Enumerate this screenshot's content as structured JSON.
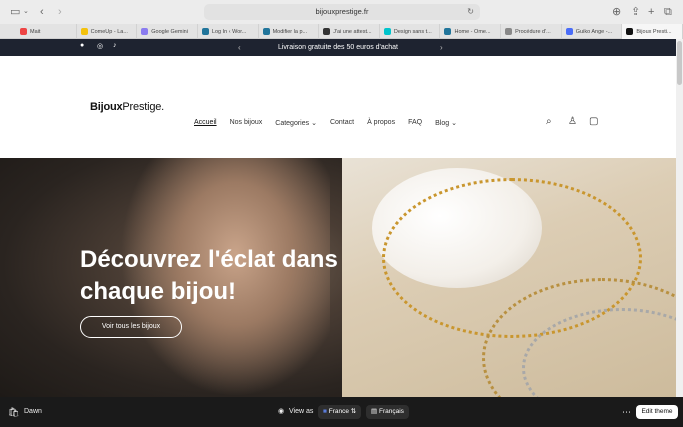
{
  "browser": {
    "url": "bijouxprestige.fr",
    "tabs": [
      {
        "label": "Mait",
        "color": "#e44"
      },
      {
        "label": "ComeUp - La...",
        "color": "#f4c20d"
      },
      {
        "label": "Google Gemini",
        "color": "#8a7cf0"
      },
      {
        "label": "Log In ‹ Wor...",
        "color": "#21759b"
      },
      {
        "label": "Modifier la p...",
        "color": "#21759b"
      },
      {
        "label": "J'ai une attest...",
        "color": "#333"
      },
      {
        "label": "Design sans t...",
        "color": "#00c4cc"
      },
      {
        "label": "Home - Ome...",
        "color": "#21759b"
      },
      {
        "label": "Procédure d'...",
        "color": "#888"
      },
      {
        "label": "Guiko Ange -...",
        "color": "#4a6cf7"
      },
      {
        "label": "Bijoux Presti...",
        "color": "#111"
      }
    ]
  },
  "announcement": {
    "message": "Livraison gratuite des 50 euros d'achat"
  },
  "header": {
    "logo_bold": "Bijoux",
    "logo_rest": "Prestige.",
    "nav": {
      "home": "Accueil",
      "jewels": "Nos bijoux",
      "categories": "Categories",
      "contact": "Contact",
      "about": "À propos",
      "faq": "FAQ",
      "blog": "Blog"
    }
  },
  "hero": {
    "title": "Découvrez l'éclat dans chaque bijou!",
    "button": "Voir tous les bijoux"
  },
  "editor_bar": {
    "theme_name": "Dawn",
    "view_as": "View as",
    "country": "France",
    "language": "Français",
    "edit_button": "Edit theme"
  }
}
